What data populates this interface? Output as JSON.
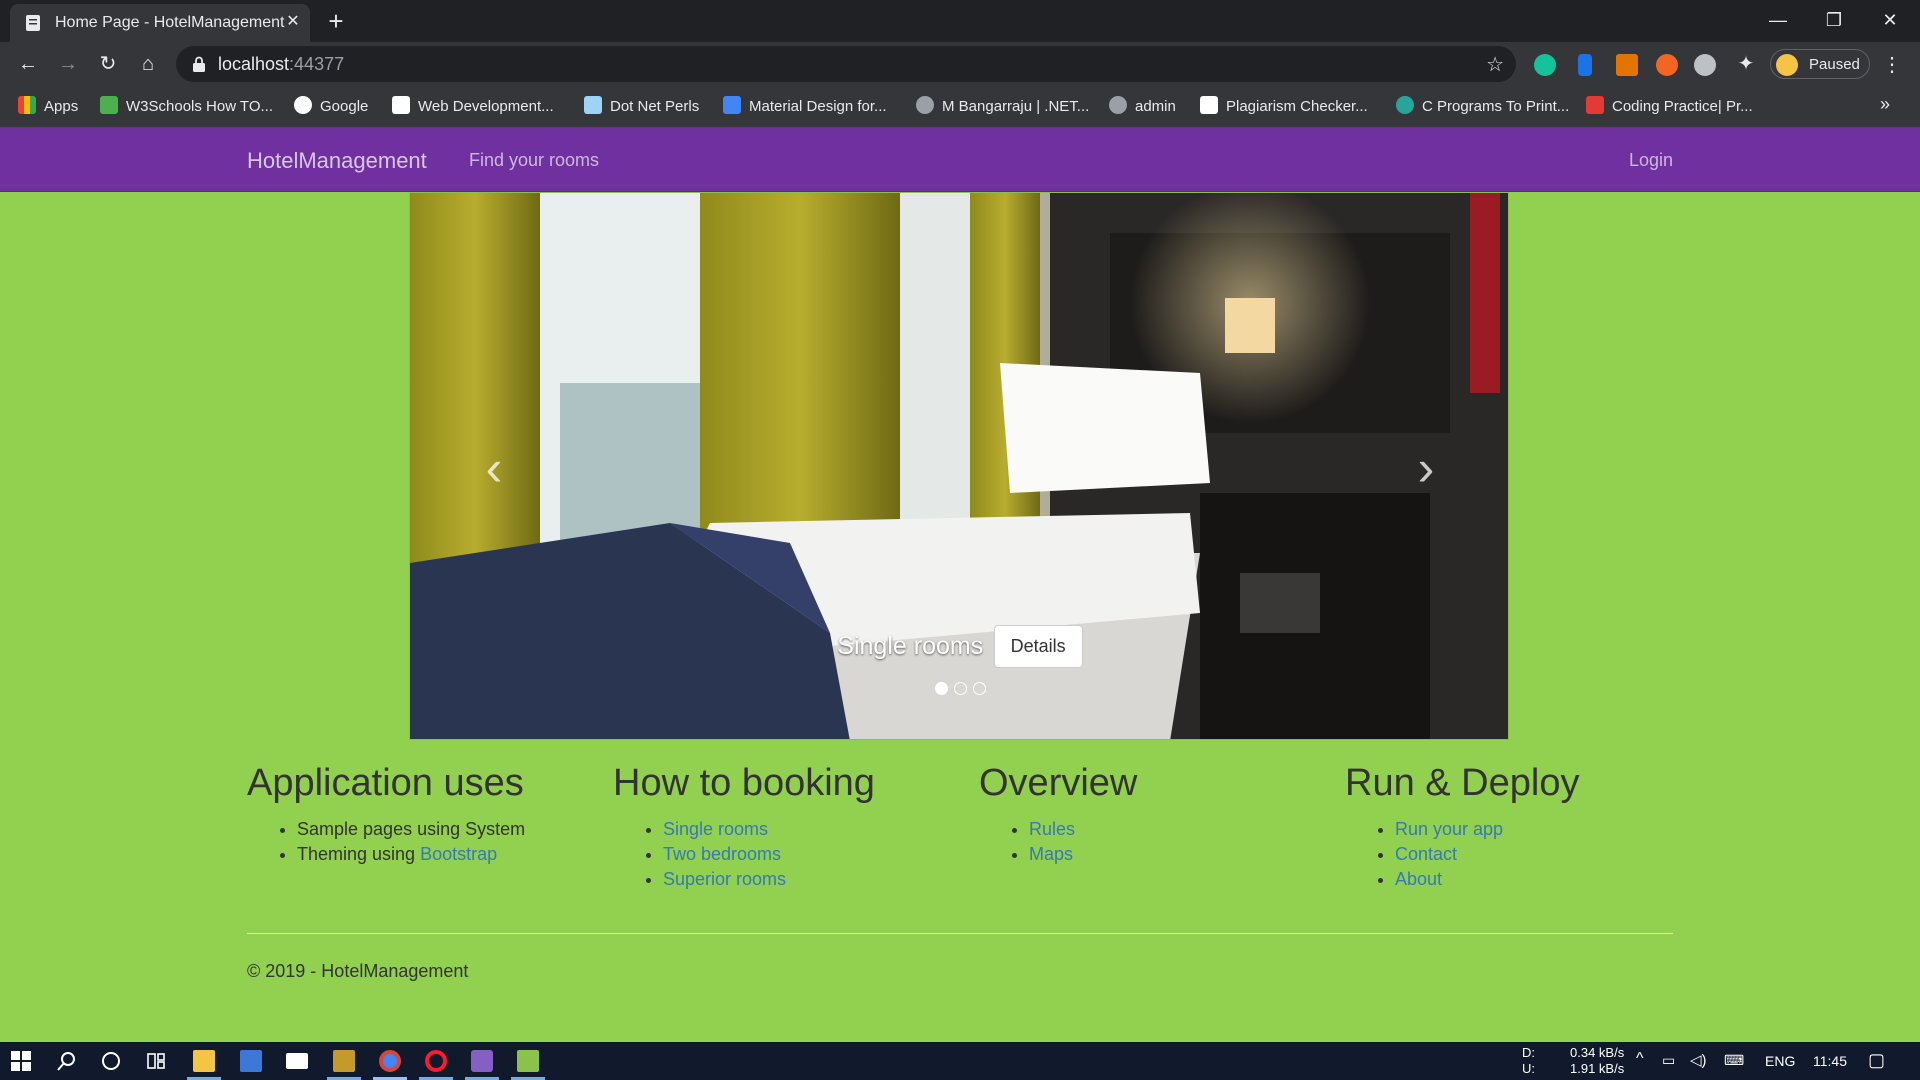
{
  "browser": {
    "tab_title": "Home Page - HotelManagement",
    "tab_close": "✕",
    "new_tab": "+",
    "url_host": "localhost",
    "url_port": ":44377",
    "profile_label": "Paused",
    "window_controls": {
      "minimize": "—",
      "restore": "❐",
      "close": "✕"
    },
    "bookmarks": [
      {
        "label": "Apps",
        "icon": "apps-grid-icon",
        "color": "#ea4335"
      },
      {
        "label": "W3Schools How TO...",
        "icon": "w3schools-icon",
        "color": "#4caf50"
      },
      {
        "label": "Google",
        "icon": "google-icon",
        "color": "#ffffff"
      },
      {
        "label": "Web Development...",
        "icon": "webdev-icon",
        "color": "#ffffff"
      },
      {
        "label": "Dot Net Perls",
        "icon": "dotnetperls-icon",
        "color": "#9fd3f5"
      },
      {
        "label": "Material Design for...",
        "icon": "mdb-icon",
        "color": "#4285f4"
      },
      {
        "label": "M Bangarraju | .NET...",
        "icon": "globe-icon",
        "color": "#9aa0a6"
      },
      {
        "label": "admin",
        "icon": "globe-icon",
        "color": "#9aa0a6"
      },
      {
        "label": "Plagiarism Checker...",
        "icon": "sst-icon",
        "color": "#ffffff"
      },
      {
        "label": "C Programs To Print...",
        "icon": "c-programs-icon",
        "color": "#26a69a"
      },
      {
        "label": "Coding Practice| Pr...",
        "icon": "tutorials-icon",
        "color": "#e53935"
      }
    ],
    "bookmarks_more": "»"
  },
  "site": {
    "brand": "HotelManagement",
    "nav_links": [
      "Find your rooms"
    ],
    "login": "Login",
    "carousel": {
      "caption_title": "Single rooms",
      "caption_button": "Details",
      "prev": "‹",
      "next": "›",
      "slides_count": 3,
      "active_slide": 1
    },
    "columns": [
      {
        "heading": "Application uses",
        "items": [
          {
            "text": "Sample pages using System",
            "link": ""
          },
          {
            "text": "Theming using ",
            "link": "Bootstrap"
          }
        ]
      },
      {
        "heading": "How to booking",
        "items": [
          {
            "text": "",
            "link": "Single rooms"
          },
          {
            "text": "",
            "link": "Two bedrooms"
          },
          {
            "text": "",
            "link": "Superior rooms"
          }
        ]
      },
      {
        "heading": "Overview",
        "items": [
          {
            "text": "",
            "link": "Rules"
          },
          {
            "text": "",
            "link": "Maps"
          }
        ]
      },
      {
        "heading": "Run & Deploy",
        "items": [
          {
            "text": "",
            "link": "Run your app"
          },
          {
            "text": "",
            "link": "Contact"
          },
          {
            "text": "",
            "link": "About"
          }
        ]
      }
    ],
    "copyright": "© 2019 - HotelManagement"
  },
  "taskbar": {
    "net_down_label": "D:",
    "net_up_label": "U:",
    "net_down": "0.34 kB/s",
    "net_up": "1.91 kB/s",
    "language": "ENG",
    "time": "11:45"
  },
  "colors": {
    "page_bg": "#92d050",
    "navbar_bg": "#7030a0",
    "link": "#337ab7"
  }
}
